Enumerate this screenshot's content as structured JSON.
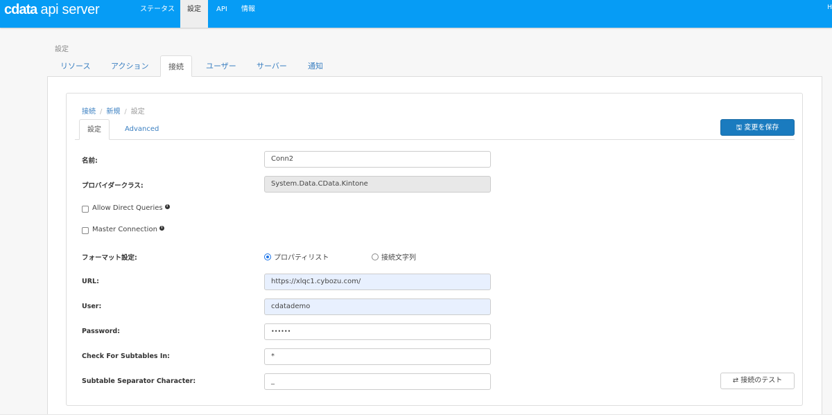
{
  "header": {
    "logo": "cdata api server",
    "logo_brand": "cdata",
    "logo_product": "api server",
    "nav": [
      {
        "label": "ステータス"
      },
      {
        "label": "設定",
        "active": true
      },
      {
        "label": "API"
      },
      {
        "label": "情報"
      }
    ],
    "corner_text": "H"
  },
  "page": {
    "title": "設定",
    "tabs": [
      {
        "label": "リソース"
      },
      {
        "label": "アクション"
      },
      {
        "label": "接続",
        "active": true
      },
      {
        "label": "ユーザー"
      },
      {
        "label": "サーバー"
      },
      {
        "label": "通知"
      }
    ]
  },
  "breadcrumb": [
    {
      "label": "接続"
    },
    {
      "label": "新規"
    },
    {
      "label": "設定"
    }
  ],
  "subtabs": [
    {
      "label": "設定",
      "active": true
    },
    {
      "label": "Advanced"
    }
  ],
  "buttons": {
    "save": "変更を保存",
    "test": "接続のテスト"
  },
  "form": {
    "name": {
      "label": "名前:",
      "value": "Conn2"
    },
    "provider": {
      "label": "プロバイダークラス:",
      "value": "System.Data.CData.Kintone"
    },
    "allow_direct": {
      "label": "Allow Direct Queries",
      "checked": false
    },
    "master": {
      "label": "Master Connection",
      "checked": false
    },
    "format": {
      "label": "フォーマット設定:",
      "options": [
        "プロパティリスト",
        "接続文字列"
      ],
      "selected": "プロパティリスト"
    },
    "url": {
      "label": "URL:",
      "value": "https://xlqc1.cybozu.com/"
    },
    "user": {
      "label": "User:",
      "value": "cdatademo"
    },
    "password": {
      "label": "Password:",
      "value": "••••••"
    },
    "subtables": {
      "label": "Check For Subtables In:",
      "value": "*"
    },
    "separator": {
      "label": "Subtable Separator Character:",
      "value": "_"
    }
  },
  "colors": {
    "topbar": "#069cf5",
    "primary": "#1a7bbf",
    "link": "#3a7fc1"
  }
}
